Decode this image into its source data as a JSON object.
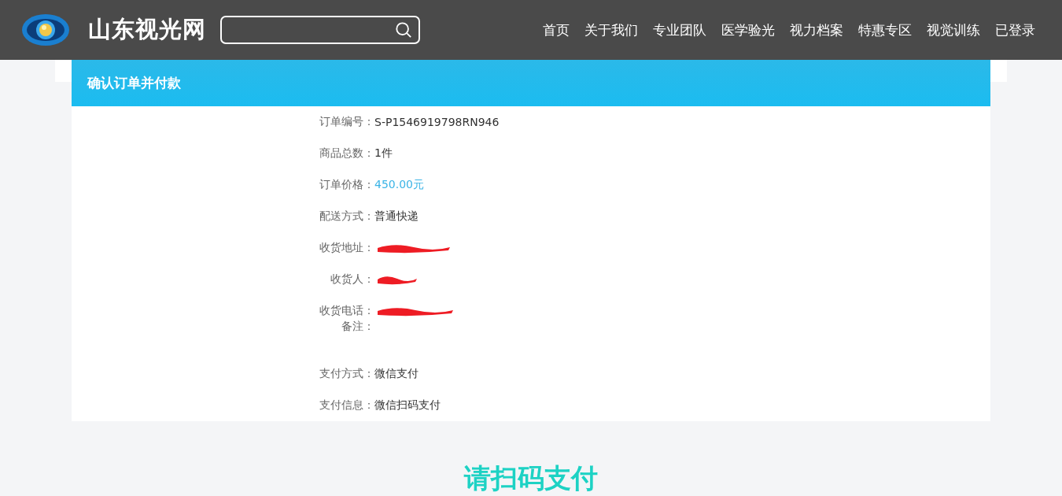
{
  "header": {
    "site_name": "山东视光网",
    "nav": [
      {
        "label": "首页"
      },
      {
        "label": "关于我们"
      },
      {
        "label": "专业团队"
      },
      {
        "label": "医学验光"
      },
      {
        "label": "视力档案"
      },
      {
        "label": "特惠专区"
      },
      {
        "label": "视觉训练"
      },
      {
        "label": "已登录"
      }
    ]
  },
  "order": {
    "title": "确认订单并付款",
    "rows": [
      {
        "kind": "plain",
        "label": "订单编号：",
        "value": "S-P1546919798RN946"
      },
      {
        "kind": "plain",
        "label": "商品总数：",
        "value": "1件"
      },
      {
        "kind": "price",
        "label": "订单价格：",
        "value": "450.00元"
      },
      {
        "kind": "plain",
        "label": "配送方式：",
        "value": "普通快递"
      },
      {
        "kind": "redacted",
        "label": "收货地址："
      },
      {
        "kind": "redacted",
        "label": "收货人："
      },
      {
        "kind": "redacted",
        "label": "收货电话："
      },
      {
        "kind": "note",
        "label": "备注："
      },
      {
        "kind": "plain",
        "label": "支付方式：",
        "value": "微信支付"
      },
      {
        "kind": "plain",
        "label": "支付信息：",
        "value": "微信扫码支付"
      }
    ]
  },
  "pay_prompt": "请扫码支付"
}
